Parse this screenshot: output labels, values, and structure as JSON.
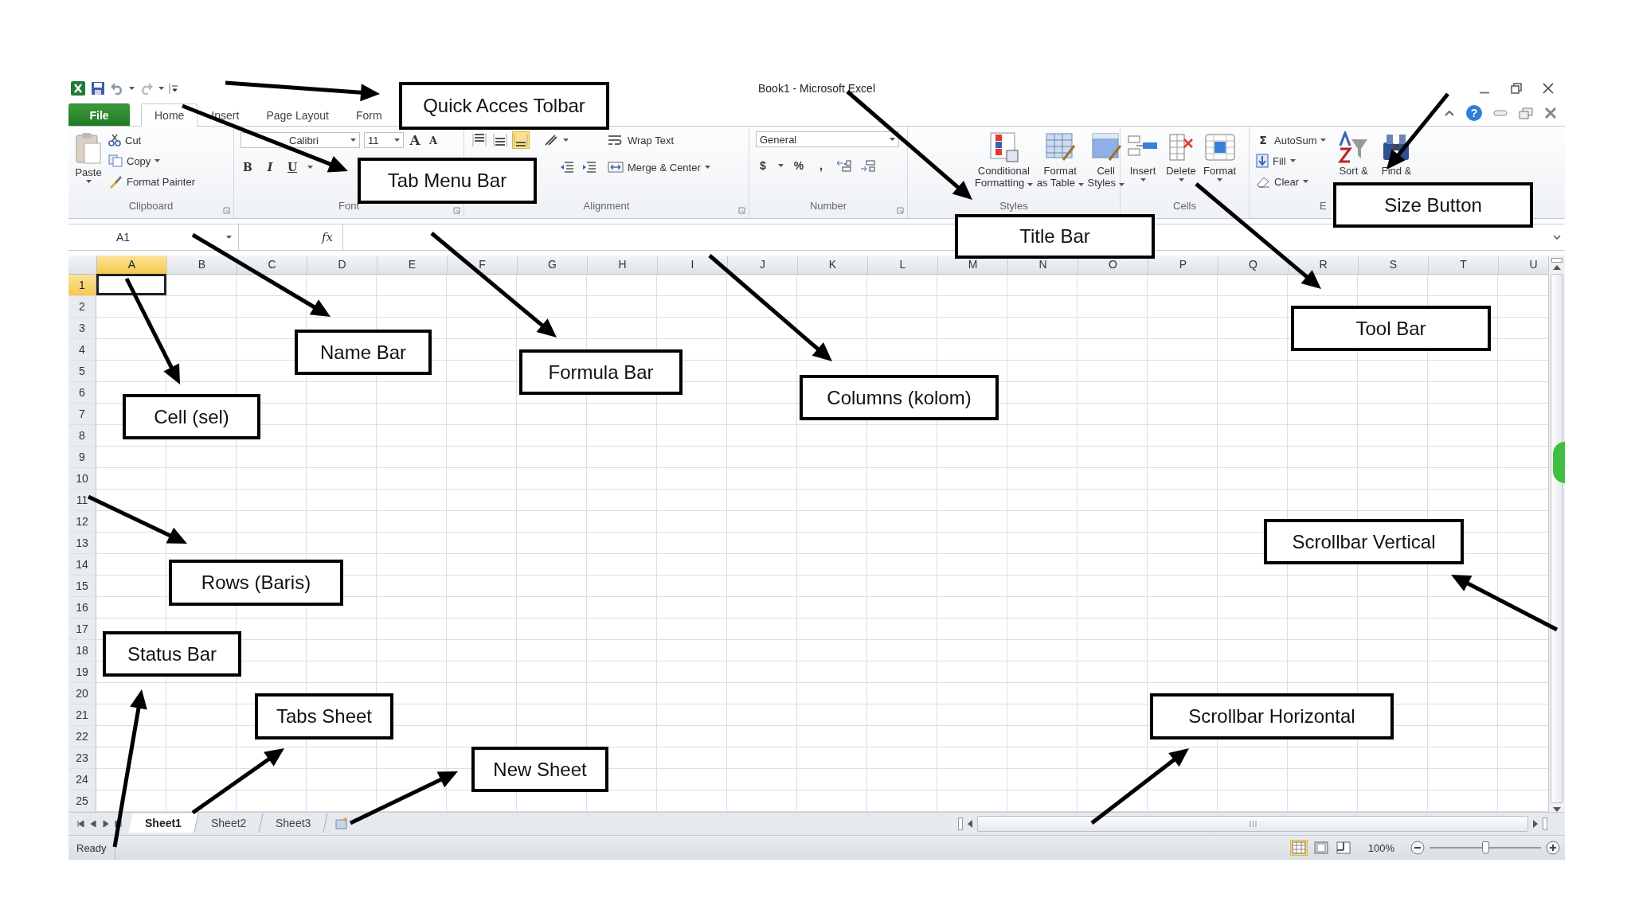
{
  "window": {
    "title": "Book1  -  Microsoft Excel"
  },
  "ribbon_tabs": [
    {
      "label": "File",
      "selected": false
    },
    {
      "label": "Home",
      "selected": true
    },
    {
      "label": "Insert",
      "selected": false
    },
    {
      "label": "Page Layout",
      "selected": false
    },
    {
      "label": "Form",
      "selected": false
    }
  ],
  "help": "?",
  "clipboard": {
    "label": "Clipboard",
    "paste": "Paste",
    "items": [
      "Cut",
      "Copy",
      "Format Painter"
    ]
  },
  "font": {
    "label": "Font",
    "font_name": "Calibri",
    "font_size": "11",
    "grow": "A",
    "shrink": "A",
    "bold": "B",
    "italic": "I",
    "underline": "U"
  },
  "alignment": {
    "label": "Alignment",
    "align_buttons": [
      {
        "selected": false
      },
      {
        "selected": false
      },
      {
        "selected": true
      }
    ],
    "items": [
      "Wrap Text",
      "Merge & Center"
    ]
  },
  "number": {
    "label": "Number",
    "format": "General",
    "currency": "$",
    "percent": "%",
    "comma": ","
  },
  "styles": {
    "label": "Styles",
    "items": [
      {
        "lines": [
          "Conditional",
          "Formatting"
        ]
      },
      {
        "lines": [
          "Format",
          "as Table"
        ]
      },
      {
        "lines": [
          "Cell",
          "Styles"
        ]
      }
    ]
  },
  "cells": {
    "label": "Cells",
    "items": [
      "Insert",
      "Delete",
      "Format"
    ]
  },
  "editing": {
    "label": "E",
    "sigma": "Σ",
    "items": [
      "AutoSum",
      "Fill",
      "Clear"
    ],
    "big": [
      "Sort &",
      "Find &"
    ]
  },
  "formula_bar": {
    "name_box": "A1",
    "fx": "fx"
  },
  "columns": [
    {
      "label": "A",
      "selected": true
    },
    {
      "label": "B",
      "selected": false
    },
    {
      "label": "C",
      "selected": false
    },
    {
      "label": "D",
      "selected": false
    },
    {
      "label": "E",
      "selected": false
    },
    {
      "label": "F",
      "selected": false
    },
    {
      "label": "G",
      "selected": false
    },
    {
      "label": "H",
      "selected": false
    },
    {
      "label": "I",
      "selected": false
    },
    {
      "label": "J",
      "selected": false
    },
    {
      "label": "K",
      "selected": false
    },
    {
      "label": "L",
      "selected": false
    },
    {
      "label": "M",
      "selected": false
    },
    {
      "label": "N",
      "selected": false
    },
    {
      "label": "O",
      "selected": false
    },
    {
      "label": "P",
      "selected": false
    },
    {
      "label": "Q",
      "selected": false
    },
    {
      "label": "R",
      "selected": false
    },
    {
      "label": "S",
      "selected": false
    },
    {
      "label": "T",
      "selected": false
    },
    {
      "label": "U",
      "selected": false
    }
  ],
  "rows": [
    {
      "label": "1",
      "selected": true
    },
    {
      "label": "2",
      "selected": false
    },
    {
      "label": "3",
      "selected": false
    },
    {
      "label": "4",
      "selected": false
    },
    {
      "label": "5",
      "selected": false
    },
    {
      "label": "6",
      "selected": false
    },
    {
      "label": "7",
      "selected": false
    },
    {
      "label": "8",
      "selected": false
    },
    {
      "label": "9",
      "selected": false
    },
    {
      "label": "10",
      "selected": false
    },
    {
      "label": "11",
      "selected": false
    },
    {
      "label": "12",
      "selected": false
    },
    {
      "label": "13",
      "selected": false
    },
    {
      "label": "14",
      "selected": false
    },
    {
      "label": "15",
      "selected": false
    },
    {
      "label": "16",
      "selected": false
    },
    {
      "label": "17",
      "selected": false
    },
    {
      "label": "18",
      "selected": false
    },
    {
      "label": "19",
      "selected": false
    },
    {
      "label": "20",
      "selected": false
    },
    {
      "label": "21",
      "selected": false
    },
    {
      "label": "22",
      "selected": false
    },
    {
      "label": "23",
      "selected": false
    },
    {
      "label": "24",
      "selected": false
    },
    {
      "label": "25",
      "selected": false
    }
  ],
  "sheet_tabs": [
    {
      "label": "Sheet1",
      "selected": true
    },
    {
      "label": "Sheet2",
      "selected": false
    },
    {
      "label": "Sheet3",
      "selected": false
    }
  ],
  "status_bar": {
    "text": "Ready",
    "view_buttons": [
      {
        "selected": true
      },
      {
        "selected": false
      },
      {
        "selected": false
      }
    ],
    "zoom": "100%",
    "zoom_slider": {
      "level": 0.5
    }
  },
  "callouts": [
    {
      "label": "Quick Acces Tolbar"
    },
    {
      "label": "Tab Menu Bar"
    },
    {
      "label": "Title Bar"
    },
    {
      "label": "Size Button"
    },
    {
      "label": "Tool Bar"
    },
    {
      "label": "Name Bar"
    },
    {
      "label": "Formula Bar"
    },
    {
      "label": "Columns (kolom)"
    },
    {
      "label": "Cell (sel)"
    },
    {
      "label": "Scrollbar Vertical"
    },
    {
      "label": "Rows (Baris)"
    },
    {
      "label": "Status Bar"
    },
    {
      "label": "Tabs Sheet"
    },
    {
      "label": "Scrollbar Horizontal"
    },
    {
      "label": "New Sheet"
    }
  ]
}
